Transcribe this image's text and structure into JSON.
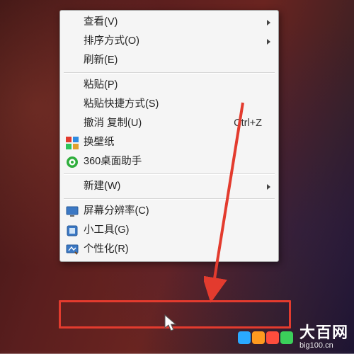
{
  "menu": {
    "items": [
      {
        "label": "查看(V)",
        "submenu": true
      },
      {
        "label": "排序方式(O)",
        "submenu": true
      },
      {
        "label": "刷新(E)"
      },
      {
        "sep": true
      },
      {
        "label": "粘贴(P)"
      },
      {
        "label": "粘贴快捷方式(S)"
      },
      {
        "label": "撤消 复制(U)",
        "shortcut": "Ctrl+Z"
      },
      {
        "label": "换壁纸",
        "icon": "wallpaper-icon"
      },
      {
        "label": "360桌面助手",
        "icon": "360-icon"
      },
      {
        "sep": true
      },
      {
        "label": "新建(W)",
        "submenu": true
      },
      {
        "sep": true
      },
      {
        "label": "屏幕分辨率(C)",
        "icon": "monitor-icon"
      },
      {
        "label": "小工具(G)",
        "icon": "gadget-icon"
      },
      {
        "label": "个性化(R)",
        "icon": "personalize-icon"
      }
    ]
  },
  "watermark": {
    "title": "大百网",
    "url": "big100.cn",
    "colors": [
      "#2aa9ff",
      "#ff9a1f",
      "#ff4d3d",
      "#3bcf5a"
    ]
  }
}
